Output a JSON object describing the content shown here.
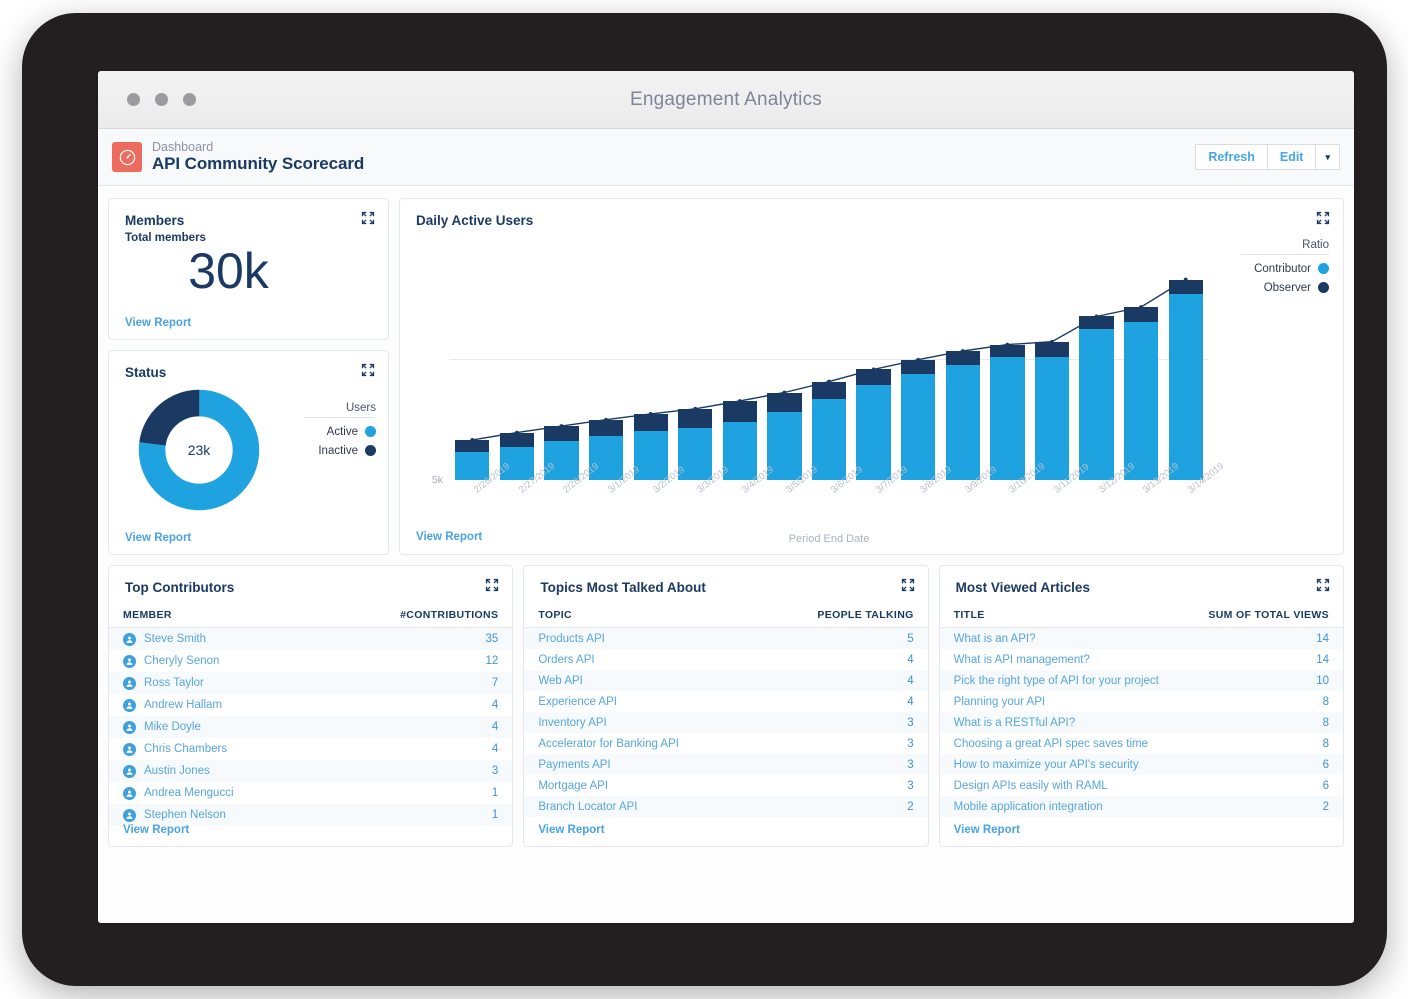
{
  "window": {
    "title": "Engagement Analytics"
  },
  "header": {
    "breadcrumb": "Dashboard",
    "page_title": "API Community Scorecard",
    "brand_icon": "gauge-icon",
    "refresh_label": "Refresh",
    "edit_label": "Edit",
    "caret_label": "▾"
  },
  "members": {
    "title": "Members",
    "subtitle": "Total members",
    "value": "30k",
    "view_report": "View Report"
  },
  "status": {
    "title": "Status",
    "center_value": "23k",
    "legend_title": "Users",
    "view_report": "View Report",
    "legend": [
      {
        "label": "Active",
        "color": "#1fa3e0",
        "percent": 77
      },
      {
        "label": "Inactive",
        "color": "#1b3a63",
        "percent": 23
      }
    ]
  },
  "chart_card": {
    "title": "Daily Active Users",
    "legend_title": "Ratio",
    "view_report": "View Report"
  },
  "chart_data": {
    "type": "bar",
    "title": "Daily Active Users",
    "xlabel": "Period End Date",
    "ylabel": "",
    "ylim": [
      0,
      10000
    ],
    "yticks": [
      "0",
      "5k"
    ],
    "ytick_values": [
      0,
      5000
    ],
    "grid": true,
    "stacked": true,
    "legend_position": "right",
    "legend_title": "Ratio",
    "overlay_line": "total",
    "categories": [
      "2/26/2019",
      "2/27/2019",
      "2/28/2019",
      "3/1/2019",
      "3/2/2019",
      "3/3/2019",
      "3/4/2019",
      "3/5/2019",
      "3/6/2019",
      "3/7/2019",
      "3/8/2019",
      "3/9/2019",
      "3/10/2019",
      "3/11/2019",
      "3/12/2019",
      "3/13/2019",
      "3/14/2019"
    ],
    "series": [
      {
        "name": "Contributor",
        "color": "#1fa3e0",
        "values": [
          1150,
          1350,
          1600,
          1800,
          2000,
          2150,
          2400,
          2800,
          3350,
          3900,
          4350,
          4750,
          5050,
          5050,
          6200,
          6500,
          7650
        ]
      },
      {
        "name": "Observer",
        "color": "#1b3a63",
        "values": [
          500,
          600,
          620,
          680,
          720,
          780,
          850,
          800,
          700,
          650,
          600,
          560,
          520,
          640,
          530,
          620,
          600
        ]
      }
    ],
    "totals": [
      1650,
      1950,
      2220,
      2480,
      2720,
      2930,
      3250,
      3600,
      4050,
      4550,
      4950,
      5310,
      5570,
      5690,
      6730,
      7120,
      8250
    ]
  },
  "top_contributors": {
    "title": "Top Contributors",
    "columns": [
      "MEMBER",
      "#CONTRIBUTIONS"
    ],
    "view_report": "View Report",
    "rows": [
      {
        "name": "Steve Smith",
        "value": "35"
      },
      {
        "name": "Cheryly Senon",
        "value": "12"
      },
      {
        "name": "Ross Taylor",
        "value": "7"
      },
      {
        "name": "Andrew Hallam",
        "value": "4"
      },
      {
        "name": "Mike Doyle",
        "value": "4"
      },
      {
        "name": "Chris Chambers",
        "value": "4"
      },
      {
        "name": "Austin Jones",
        "value": "3"
      },
      {
        "name": "Andrea Mengucci",
        "value": "1"
      },
      {
        "name": "Stephen Nelson",
        "value": "1"
      }
    ]
  },
  "topics": {
    "title": "Topics Most Talked About",
    "columns": [
      "TOPIC",
      "PEOPLE TALKING"
    ],
    "view_report": "View Report",
    "rows": [
      {
        "name": "Products API",
        "value": "5"
      },
      {
        "name": "Orders API",
        "value": "4"
      },
      {
        "name": "Web API",
        "value": "4"
      },
      {
        "name": "Experience API",
        "value": "4"
      },
      {
        "name": "Inventory API",
        "value": "3"
      },
      {
        "name": "Accelerator for Banking API",
        "value": "3"
      },
      {
        "name": "Payments API",
        "value": "3"
      },
      {
        "name": "Mortgage API",
        "value": "3"
      },
      {
        "name": "Branch Locator API",
        "value": "2"
      }
    ]
  },
  "articles": {
    "title": "Most Viewed Articles",
    "columns": [
      "TITLE",
      "SUM OF TOTAL VIEWS"
    ],
    "view_report": "View Report",
    "rows": [
      {
        "name": "What is an API?",
        "value": "14"
      },
      {
        "name": "What is API management?",
        "value": "14"
      },
      {
        "name": "Pick the right type of API for your project",
        "value": "10"
      },
      {
        "name": "Planning your API",
        "value": "8"
      },
      {
        "name": "What is a RESTful API?",
        "value": "8"
      },
      {
        "name": "Choosing a great API spec saves time",
        "value": "8"
      },
      {
        "name": "How to maximize your API's security",
        "value": "6"
      },
      {
        "name": "Design APIs easily with RAML",
        "value": "6"
      },
      {
        "name": "Mobile application integration",
        "value": "2"
      }
    ]
  },
  "colors": {
    "accent_blue": "#1fa3e0",
    "navy": "#1b3a63",
    "link": "#4aa3e5",
    "brand_red": "#ec6a5e"
  }
}
